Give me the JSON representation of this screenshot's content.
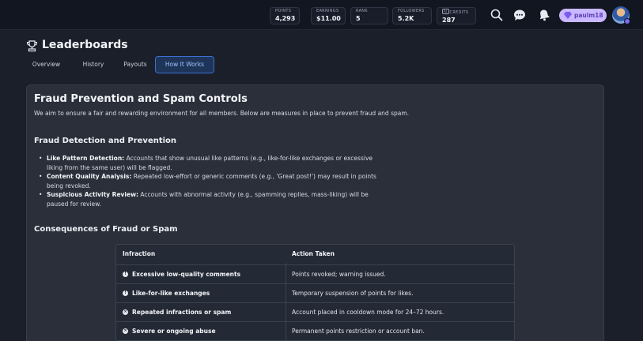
{
  "topbar": {
    "stats": [
      {
        "label": "POINTS",
        "value": "4,293"
      },
      {
        "label": "EARNINGS",
        "value": "$11.00"
      },
      {
        "label": "RANK",
        "value": "5"
      },
      {
        "label": "FOLLOWERS",
        "value": "5.2K"
      },
      {
        "badge": "AI",
        "label": "CREDITS",
        "value": "287"
      }
    ],
    "icons": [
      "search-icon",
      "chat-bubble-icon",
      "bell-icon"
    ],
    "username": "paulm18",
    "accent_color": "#c9b8ff"
  },
  "page": {
    "title": "Leaderboards",
    "title_icon": "trophy-icon",
    "tabs": [
      {
        "label": "Overview",
        "active": false
      },
      {
        "label": "History",
        "active": false
      },
      {
        "label": "Payouts",
        "active": false
      },
      {
        "label": "How It Works",
        "active": true
      }
    ]
  },
  "content": {
    "heading": "Fraud Prevention and Spam Controls",
    "intro": "We aim to ensure a fair and rewarding environment for all members. Below are measures in place to prevent fraud and spam.",
    "detection_heading": "Fraud Detection and Prevention",
    "measures": [
      {
        "title": "Like Pattern Detection:",
        "text": " Accounts that show unusual like patterns (e.g., like-for-like exchanges or excessive liking from the same user) will be flagged."
      },
      {
        "title": "Content Quality Analysis:",
        "text": " Repeated low-effort or generic comments (e.g., 'Great post!') may result in points being revoked."
      },
      {
        "title": "Suspicious Activity Review:",
        "text": " Accounts with abnormal activity (e.g., spamming replies, mass-liking) will be paused for review."
      }
    ],
    "consequences_heading": "Consequences of Fraud or Spam",
    "table": {
      "headers": [
        "Infraction",
        "Action Taken"
      ],
      "rows": [
        {
          "icon": "warning-icon",
          "symbol": "!",
          "infraction": "Excessive low-quality comments",
          "action": "Points revoked; warning issued."
        },
        {
          "icon": "warning-icon",
          "symbol": "!",
          "infraction": "Like-for-like exchanges",
          "action": "Temporary suspension of points for likes."
        },
        {
          "icon": "block-icon",
          "symbol": "×",
          "infraction": "Repeated infractions or spam",
          "action": "Account placed in cooldown mode for 24–72 hours."
        },
        {
          "icon": "block-icon",
          "symbol": "×",
          "infraction": "Severe or ongoing abuse",
          "action": "Permanent points restriction or account ban."
        }
      ]
    }
  }
}
